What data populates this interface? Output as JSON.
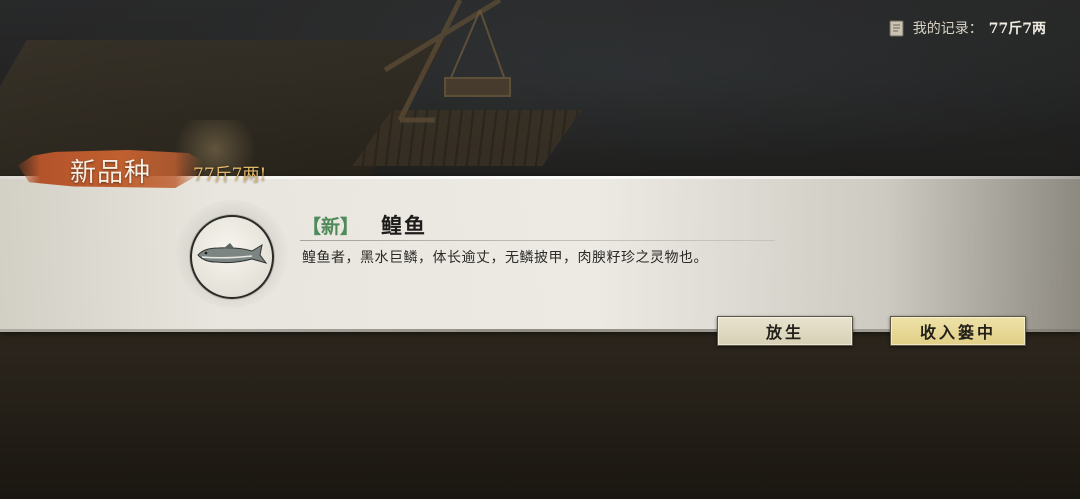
{
  "header": {
    "record_label": "我的记录：",
    "record_value": "77斤7两",
    "record_icon": "scroll-book-icon"
  },
  "popup": {
    "tag_label": "新品种",
    "weight_text": "77斤7两!",
    "fish": {
      "new_marker": "【新】",
      "name": "鳇鱼",
      "description": "鳇鱼者，黑水巨鳞，体长逾丈，无鳞披甲，肉腴籽珍之灵物也。",
      "icon": "sturgeon-fish-icon"
    },
    "buttons": {
      "release": "放生",
      "keep": "收入篓中"
    }
  },
  "colors": {
    "tag_red": "#b3532b",
    "weight_gold": "#e3b96a",
    "new_green": "#4e8a5a",
    "keep_button": "#e0cf86",
    "release_button": "#d7d0b6"
  }
}
